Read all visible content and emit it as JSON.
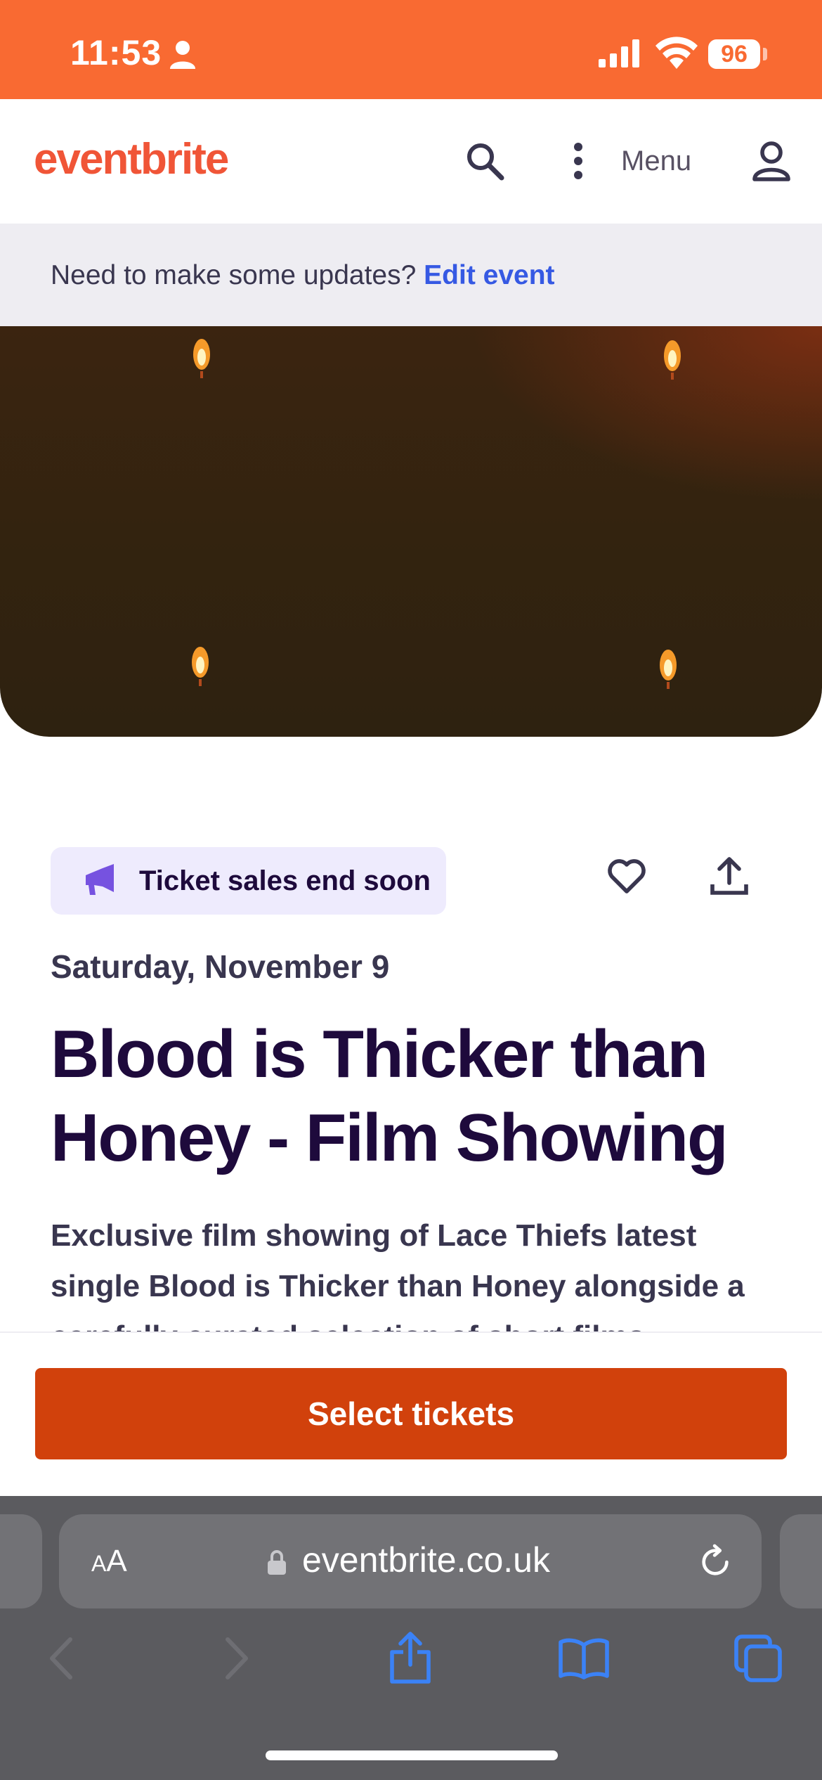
{
  "status_bar": {
    "time": "11:53",
    "battery": "96",
    "background": "#f96a32"
  },
  "header": {
    "logo": "eventbrite",
    "menu_label": "Menu",
    "icons": [
      "search-icon",
      "more-vertical-icon",
      "account-icon"
    ],
    "logo_color": "#f05537"
  },
  "edit_notice": {
    "text": "Need to make some updates?",
    "link": "Edit event"
  },
  "event": {
    "badge": "Ticket sales end soon",
    "badge_icon": "megaphone-icon",
    "date": "Saturday, November 9",
    "title": "Blood is Thicker than Honey - Film Showing",
    "summary": "Exclusive film showing of Lace Thiefs latest single Blood is Thicker than Honey alongside a carefully curated selection of short films"
  },
  "footer": {
    "cta": "Select tickets",
    "cta_color": "#d1410c"
  },
  "browser": {
    "aa_label_big": "A",
    "aa_label_small": "A",
    "url": "eventbrite.co.uk",
    "icons": [
      "back-icon",
      "forward-icon",
      "share-icon",
      "bookmarks-icon",
      "tabs-icon",
      "reload-icon",
      "lock-icon"
    ]
  }
}
